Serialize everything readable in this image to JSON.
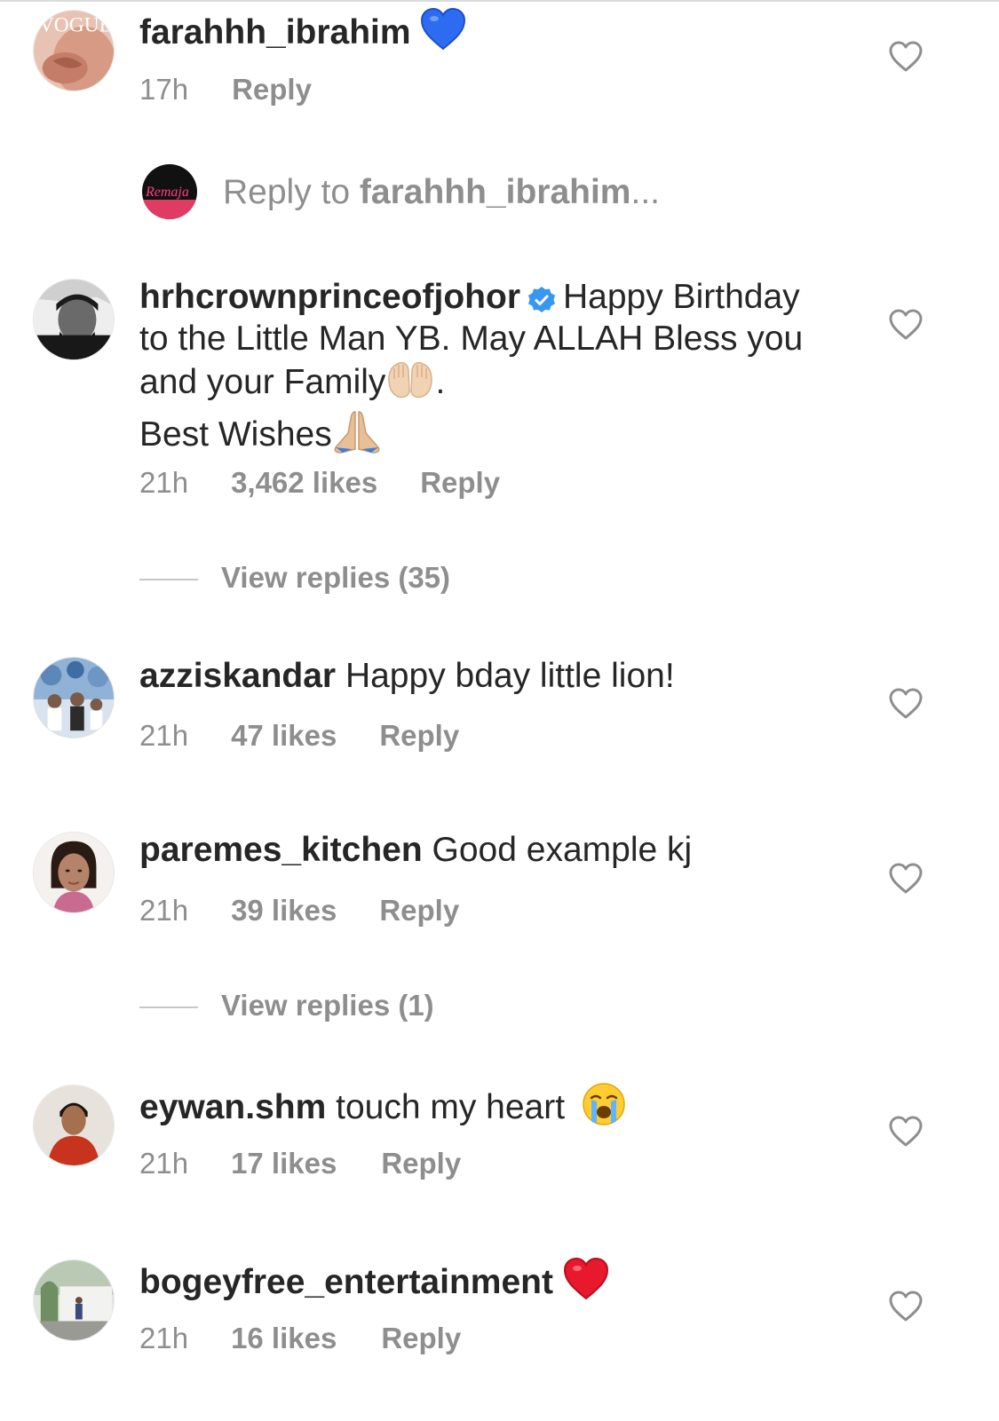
{
  "comments": [
    {
      "username": "farahhh_ibrahim",
      "text": "",
      "emoji": "blue-heart",
      "time": "17h",
      "likes": "",
      "reply": "Reply",
      "avatar_text": "VOGUE"
    },
    {
      "username": "hrhcrownprinceofjohor",
      "verified": true,
      "text_part1": "Happy Birthday to the Little Man YB. May ALLAH Bless you and your Family",
      "text_part2": ".",
      "text_part3": "Best Wishes",
      "time": "21h",
      "likes": "3,462 likes",
      "reply": "Reply",
      "view_replies": "View replies (35)"
    },
    {
      "username": "azziskandar",
      "text": "Happy bday little lion!",
      "time": "21h",
      "likes": "47 likes",
      "reply": "Reply"
    },
    {
      "username": "paremes_kitchen",
      "text": "Good example kj",
      "time": "21h",
      "likes": "39 likes",
      "reply": "Reply",
      "view_replies": "View replies (1)"
    },
    {
      "username": "eywan.shm",
      "text": "touch my heart",
      "emoji": "crying-face",
      "time": "21h",
      "likes": "17 likes",
      "reply": "Reply"
    },
    {
      "username": "bogeyfree_entertainment",
      "text": "",
      "emoji": "red-heart",
      "time": "21h",
      "likes": "16 likes",
      "reply": "Reply"
    }
  ],
  "reply_input": {
    "prefix": "Reply to ",
    "target": "farahhh_ibrahim",
    "suffix": "...",
    "avatar_text": "Remaja"
  },
  "colors": {
    "meta_gray": "#8e8e8e",
    "verified_blue": "#3897f0",
    "text": "#262626"
  }
}
